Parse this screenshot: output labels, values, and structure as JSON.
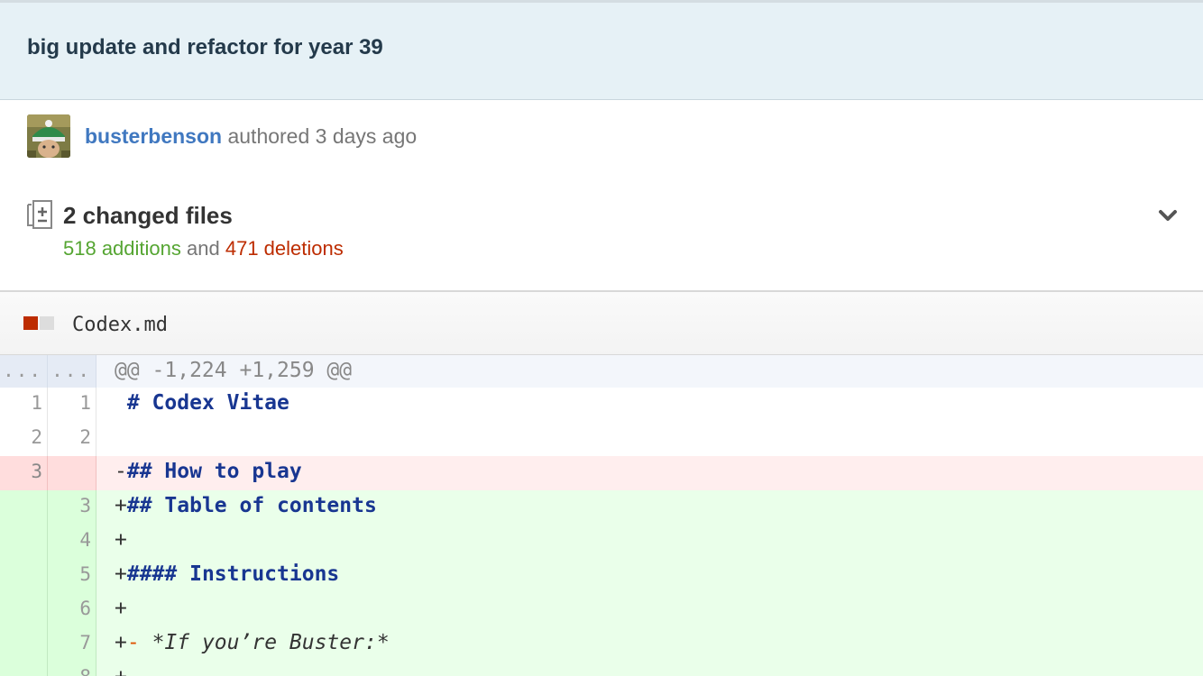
{
  "commit": {
    "title": "big update and refactor for year 39",
    "author": "busterbenson",
    "authored_text": "authored 3 days ago"
  },
  "summary": {
    "changed_files": "2 changed files",
    "additions": "518 additions",
    "and": "and",
    "deletions": "471 deletions"
  },
  "file": {
    "name": "Codex.md"
  },
  "diff": {
    "hunk": {
      "old": "...",
      "new": "...",
      "text": "@@ -1,224 +1,259 @@"
    },
    "lines": [
      {
        "type": "ctx",
        "old": "1",
        "new": "1",
        "sign": " ",
        "text": "# Codex Vitae",
        "style": "heading"
      },
      {
        "type": "ctx",
        "old": "2",
        "new": "2",
        "sign": " ",
        "text": "",
        "style": "plain"
      },
      {
        "type": "del",
        "old": "3",
        "new": "",
        "sign": "-",
        "text": "## How to play",
        "style": "heading"
      },
      {
        "type": "add",
        "old": "",
        "new": "3",
        "sign": "+",
        "text": "## Table of contents",
        "style": "heading"
      },
      {
        "type": "add",
        "old": "",
        "new": "4",
        "sign": "+",
        "text": "",
        "style": "plain"
      },
      {
        "type": "add",
        "old": "",
        "new": "5",
        "sign": "+",
        "text": "#### Instructions",
        "style": "heading"
      },
      {
        "type": "add",
        "old": "",
        "new": "6",
        "sign": "+",
        "text": "",
        "style": "plain"
      },
      {
        "type": "add",
        "old": "",
        "new": "7",
        "sign": "+",
        "bullet": "-",
        "text": " *If you’re Buster:*",
        "style": "italic"
      },
      {
        "type": "add",
        "old": "",
        "new": "8",
        "sign": "+",
        "text": "",
        "style": "plain"
      }
    ]
  },
  "colors": {
    "addition": "#55a532",
    "deletion": "#bd2c00",
    "author_link": "#4078c0"
  }
}
